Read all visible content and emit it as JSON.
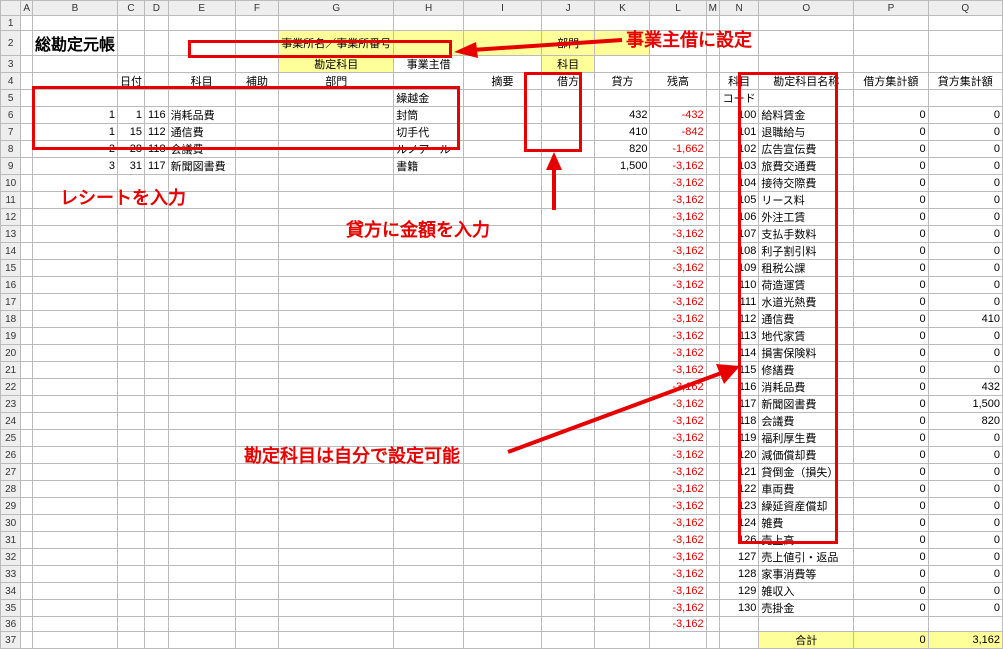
{
  "columns": [
    "A",
    "B",
    "C",
    "D",
    "E",
    "F",
    "G",
    "H",
    "I",
    "J",
    "K",
    "L",
    "M",
    "N",
    "O",
    "P",
    "Q"
  ],
  "row_count": 37,
  "title": "総勘定元帳",
  "headers": {
    "row2": {
      "G": "事業所名／事業所番号",
      "J": "部門"
    },
    "row3": {
      "G": "勘定科目",
      "H": "事業主借",
      "J": "科目"
    },
    "row4": {
      "C": "日付",
      "E": "科目",
      "F": "補助",
      "G": "部門",
      "I": "摘要",
      "J": "借方",
      "K": "貸方",
      "L": "残高",
      "N": "科目",
      "O": "勘定科目名称",
      "P": "借方集計額",
      "Q": "貸方集計額"
    },
    "row5": {
      "H": "繰越金",
      "N": "コード"
    }
  },
  "ledger_rows": [
    {
      "m": "1",
      "d": "1",
      "code": "116",
      "name": "消耗品費",
      "memo": "封筒",
      "credit": "432",
      "bal": "-432"
    },
    {
      "m": "1",
      "d": "15",
      "code": "112",
      "name": "通信費",
      "memo": "切手代",
      "credit": "410",
      "bal": "-842"
    },
    {
      "m": "2",
      "d": "28",
      "code": "118",
      "name": "会議費",
      "memo": "ルノアール",
      "credit": "820",
      "bal": "-1,662"
    },
    {
      "m": "3",
      "d": "31",
      "code": "117",
      "name": "新聞図書費",
      "memo": "書籍",
      "credit": "1,500",
      "bal": "-3,162"
    }
  ],
  "balance_fill": "-3,162",
  "balance_fill_count": 27,
  "accounts": [
    {
      "code": "100",
      "name": "給料賃金",
      "p": "0",
      "q": "0"
    },
    {
      "code": "101",
      "name": "退職給与",
      "p": "0",
      "q": "0"
    },
    {
      "code": "102",
      "name": "広告宣伝費",
      "p": "0",
      "q": "0"
    },
    {
      "code": "103",
      "name": "旅費交通費",
      "p": "0",
      "q": "0"
    },
    {
      "code": "104",
      "name": "接待交際費",
      "p": "0",
      "q": "0"
    },
    {
      "code": "105",
      "name": "リース料",
      "p": "0",
      "q": "0"
    },
    {
      "code": "106",
      "name": "外注工賃",
      "p": "0",
      "q": "0"
    },
    {
      "code": "107",
      "name": "支払手数料",
      "p": "0",
      "q": "0"
    },
    {
      "code": "108",
      "name": "利子割引料",
      "p": "0",
      "q": "0"
    },
    {
      "code": "109",
      "name": "租税公課",
      "p": "0",
      "q": "0"
    },
    {
      "code": "110",
      "name": "荷造運賃",
      "p": "0",
      "q": "0"
    },
    {
      "code": "111",
      "name": "水道光熱費",
      "p": "0",
      "q": "0"
    },
    {
      "code": "112",
      "name": "通信費",
      "p": "0",
      "q": "410"
    },
    {
      "code": "113",
      "name": "地代家賃",
      "p": "0",
      "q": "0"
    },
    {
      "code": "114",
      "name": "損害保険料",
      "p": "0",
      "q": "0"
    },
    {
      "code": "115",
      "name": "修繕費",
      "p": "0",
      "q": "0"
    },
    {
      "code": "116",
      "name": "消耗品費",
      "p": "0",
      "q": "432"
    },
    {
      "code": "117",
      "name": "新聞図書費",
      "p": "0",
      "q": "1,500"
    },
    {
      "code": "118",
      "name": "会議費",
      "p": "0",
      "q": "820"
    },
    {
      "code": "119",
      "name": "福利厚生費",
      "p": "0",
      "q": "0"
    },
    {
      "code": "120",
      "name": "減価償却費",
      "p": "0",
      "q": "0"
    },
    {
      "code": "121",
      "name": "貸倒金（損失）",
      "p": "0",
      "q": "0"
    },
    {
      "code": "122",
      "name": "車両費",
      "p": "0",
      "q": "0"
    },
    {
      "code": "123",
      "name": "繰延資産償却",
      "p": "0",
      "q": "0"
    },
    {
      "code": "124",
      "name": "雑費",
      "p": "0",
      "q": "0"
    },
    {
      "code": "126",
      "name": "売上高",
      "p": "0",
      "q": "0"
    },
    {
      "code": "127",
      "name": "売上値引・返品",
      "p": "0",
      "q": "0"
    },
    {
      "code": "128",
      "name": "家事消費等",
      "p": "0",
      "q": "0"
    },
    {
      "code": "129",
      "name": "雑収入",
      "p": "0",
      "q": "0"
    },
    {
      "code": "130",
      "name": "売掛金",
      "p": "0",
      "q": "0"
    }
  ],
  "totals": {
    "label": "合計",
    "p": "0",
    "q": "3,162"
  },
  "annotations": {
    "a1": "事業主借に設定",
    "a2": "レシートを入力",
    "a3": "貸方に金額を入力",
    "a4": "勘定科目は自分で設定可能"
  },
  "col_widths": {
    "row": 22,
    "A": 10,
    "B": 24,
    "C": 24,
    "D": 24,
    "E": 70,
    "F": 50,
    "G": 50,
    "H": 74,
    "I": 98,
    "J": 64,
    "K": 64,
    "L": 64,
    "M": 8,
    "N": 40,
    "O": 100,
    "P": 80,
    "Q": 80
  }
}
